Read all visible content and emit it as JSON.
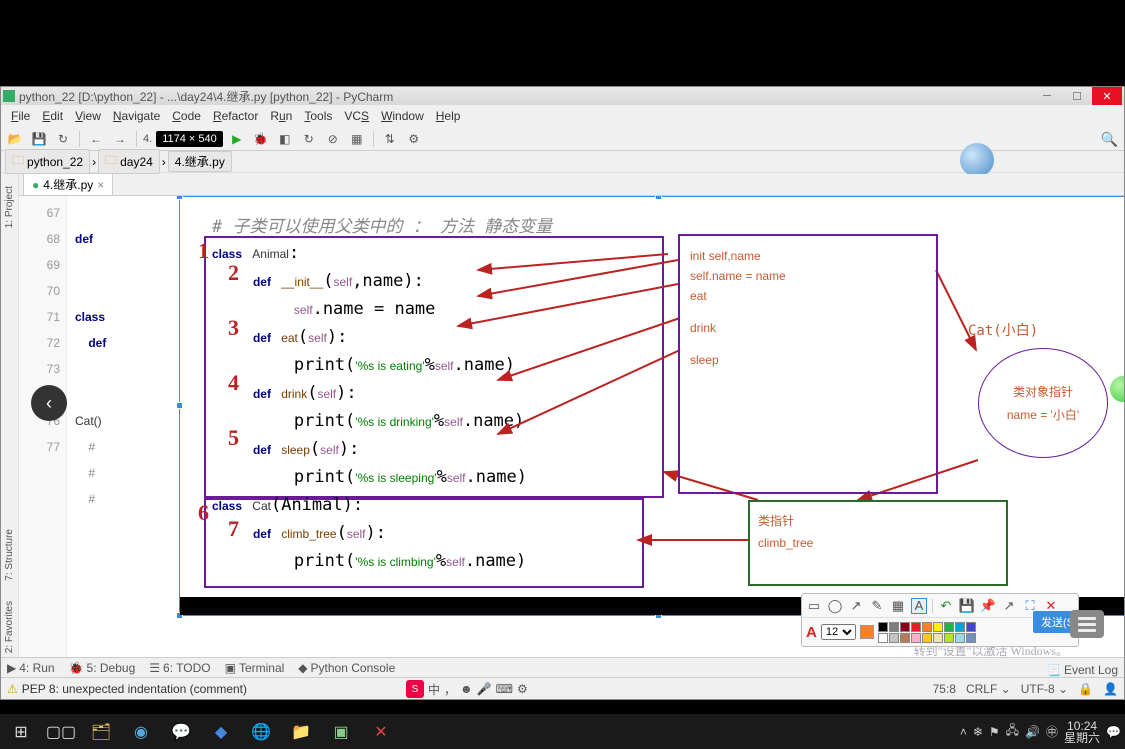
{
  "title": "python_22 [D:\\python_22] - ...\\day24\\4.继承.py [python_22] - PyCharm",
  "menu": [
    "File",
    "Edit",
    "View",
    "Navigate",
    "Code",
    "Refactor",
    "Run",
    "Tools",
    "VCS",
    "Window",
    "Help"
  ],
  "dim_badge": "1174 × 540",
  "breadcrumbs": [
    "python_22",
    "day24",
    "4.继承.py"
  ],
  "tab": {
    "name": "4.继承.py",
    "close": "×"
  },
  "line_numbers": [
    "67",
    "68",
    "69",
    "70",
    "71",
    "72",
    "73",
    "",
    "75",
    "76",
    "77"
  ],
  "bg_code": {
    "l67": "def",
    "l70": "class",
    "l71": "    def",
    "l74": "Cat()",
    "l75": "    # ",
    "l76": "    # ",
    "l77": "    # "
  },
  "slide": {
    "comment": "# 子类可以使用父类中的 ： 方法 静态变量",
    "code": "class Animal:\n    def __init__(self,name):\n        self.name = name\n    def eat(self):\n        print('%s is eating'%self.name)\n    def drink(self):\n        print('%s is drinking'%self.name)\n    def sleep(self):\n        print('%s is sleeping'%self.name)\nclass Cat(Animal):\n    def climb_tree(self):\n        print('%s is climbing'%self.name)",
    "num1": "1",
    "num2": "2",
    "num3": "3",
    "num4": "4",
    "num5": "5",
    "num6": "6",
    "num7": "7"
  },
  "right_box1": {
    "l1": "init  self,name",
    "l2": "self.name = name",
    "l3": "eat",
    "l4": "drink",
    "l5": "sleep"
  },
  "cat_label": "Cat(小白)",
  "oval": {
    "l1": "类对象指针",
    "l2": "name = '小白'"
  },
  "right_box2": {
    "l1": "类指针",
    "l2": "climb_tree"
  },
  "left_tabs": [
    "1: Project",
    "7: Structure",
    "2: Favorites"
  ],
  "bottom": {
    "run": "4: Run",
    "debug": "5: Debug",
    "todo": "6: TODO",
    "terminal": "Terminal",
    "pyconsole": "Python Console"
  },
  "event_log": "Event Log",
  "status": {
    "warn": "PEP 8: unexpected indentation (comment)",
    "pos": "75:8",
    "crlf": "CRLF",
    "enc": "UTF-8"
  },
  "ime": "中",
  "watermark": "转到\"设置\"以激活 Windows。",
  "anno": {
    "font_size": "12"
  },
  "palette_colors": [
    "#000",
    "#7f7f7f",
    "#880015",
    "#ed1c24",
    "#ff7f27",
    "#fff200",
    "#22b14c",
    "#00a2e8",
    "#3f48cc",
    "#fff",
    "#c3c3c3",
    "#b97a57",
    "#ffaec9",
    "#ffc90e",
    "#efe4b0",
    "#b5e61d",
    "#99d9ea",
    "#7092be"
  ],
  "tray_icons": [
    "▲",
    "⛅",
    "🔋",
    "📶",
    "🔊",
    "●"
  ],
  "clock": {
    "time": "10:24",
    "date": "星期六"
  },
  "send_btn": "发送(S)"
}
